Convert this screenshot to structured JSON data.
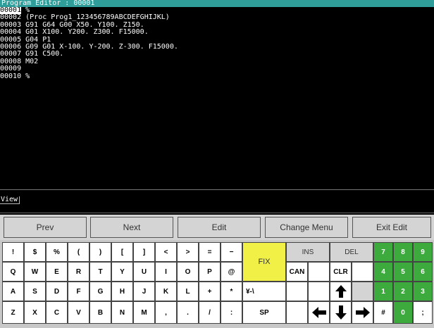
{
  "title": "Program Editor : 00001",
  "editor": {
    "lines": [
      {
        "num": "00001",
        "text": " %",
        "current": true
      },
      {
        "num": "00002",
        "text": " (Proc Prog1_123456789ABCDEFGHIJKL)",
        "current": false
      },
      {
        "num": "00003",
        "text": " G91 G64 G00 X50. Y100. Z150.",
        "current": false
      },
      {
        "num": "00004",
        "text": " G01 X100. Y200. Z300. F15000.",
        "current": false
      },
      {
        "num": "00005",
        "text": " G04 P1",
        "current": false
      },
      {
        "num": "00006",
        "text": " G09 G01 X-100. Y-200. Z-300. F15000.",
        "current": false
      },
      {
        "num": "00007",
        "text": " G91 C500.",
        "current": false
      },
      {
        "num": "00008",
        "text": " M02",
        "current": false
      },
      {
        "num": "00009",
        "text": "",
        "current": false
      },
      {
        "num": "00010",
        "text": " %",
        "current": false
      }
    ]
  },
  "view": {
    "label": "View"
  },
  "softkeys": {
    "prev": "Prev",
    "next": "Next",
    "edit": "Edit",
    "change_menu": "Change Menu",
    "exit_edit": "Exit Edit"
  },
  "keys": {
    "exclaim": "!",
    "dollar": "$",
    "percent": "%",
    "lparen": "(",
    "rparen": ")",
    "lbracket": "[",
    "rbracket": "]",
    "lt": "<",
    "gt": ">",
    "equals": "=",
    "minus": "−",
    "Q": "Q",
    "W": "W",
    "E": "E",
    "R": "R",
    "T": "T",
    "Y": "Y",
    "U": "U",
    "I": "I",
    "O": "O",
    "P": "P",
    "at": "@",
    "A": "A",
    "S": "S",
    "D": "D",
    "F": "F",
    "G": "G",
    "H": "H",
    "J": "J",
    "K": "K",
    "L": "L",
    "plus": "+",
    "asterisk": "*",
    "yen": "¥-\\",
    "Z": "Z",
    "X": "X",
    "C": "C",
    "V": "V",
    "B": "B",
    "N": "N",
    "M": "M",
    "comma": ",",
    "period": ".",
    "slash": "/",
    "colon": ":",
    "sp": "SP",
    "fix": "FIX",
    "ins": "INS",
    "del": "DEL",
    "can": "CAN",
    "clr": "CLR",
    "n7": "7",
    "n8": "8",
    "n9": "9",
    "n4": "4",
    "n5": "5",
    "n6": "6",
    "n1": "1",
    "n2": "2",
    "n3": "3",
    "hash": "#",
    "n0": "0",
    "semicolon": ";"
  },
  "colors": {
    "title_bar": "#2f9d9a",
    "fix_key": "#f0f046",
    "numpad": "#3daa3d"
  }
}
